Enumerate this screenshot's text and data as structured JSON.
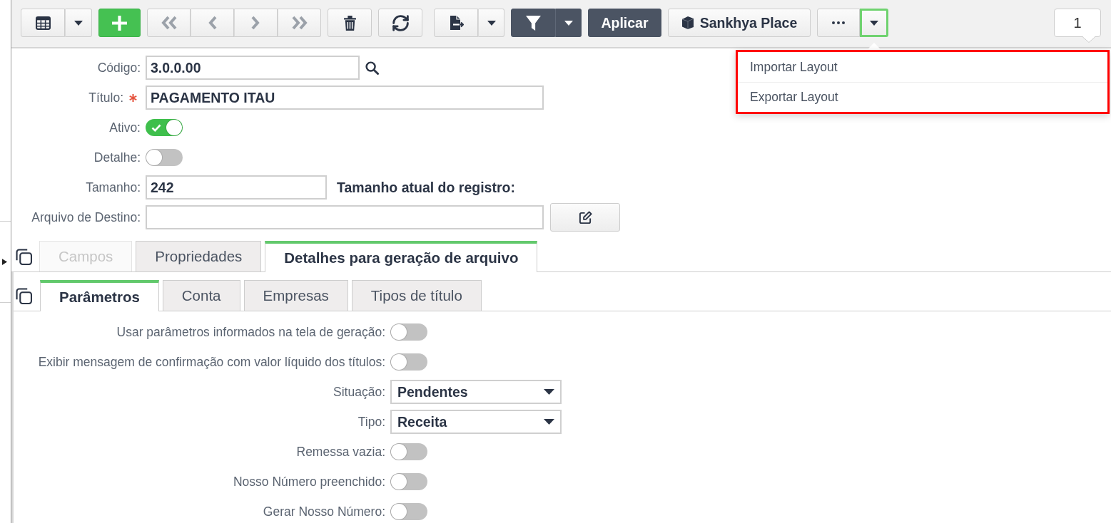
{
  "toolbar": {
    "apply_label": "Aplicar",
    "place_label": "Sankhya Place",
    "record_count": "1"
  },
  "more_menu": {
    "open": true,
    "highlighted": true,
    "items": [
      {
        "label": "Importar Layout"
      },
      {
        "label": "Exportar Layout"
      }
    ]
  },
  "form": [
    {
      "kind": "lookup",
      "label": "Código:",
      "required": false,
      "value": "3.0.0.00"
    },
    {
      "kind": "text",
      "label": "Título:",
      "required": true,
      "value": "PAGAMENTO ITAU"
    },
    {
      "kind": "switch",
      "label": "Ativo:",
      "required": false,
      "on": true
    },
    {
      "kind": "switch",
      "label": "Detalhe:",
      "required": false,
      "on": false
    },
    {
      "kind": "number",
      "label": "Tamanho:",
      "required": false,
      "value": "242",
      "note": "Tamanho atual do registro:"
    },
    {
      "kind": "file",
      "label": "Arquivo de Destino:",
      "required": false
    }
  ],
  "tabs": [
    {
      "label": "Campos",
      "selected": false,
      "disabled": true
    },
    {
      "label": "Propriedades",
      "selected": false,
      "disabled": false
    },
    {
      "label": "Detalhes para geração de arquivo",
      "selected": true,
      "disabled": false
    }
  ],
  "subtabs": [
    {
      "label": "Parâmetros",
      "selected": true
    },
    {
      "label": "Conta",
      "selected": false
    },
    {
      "label": "Empresas",
      "selected": false
    },
    {
      "label": "Tipos de título",
      "selected": false
    }
  ],
  "parameters": [
    {
      "kind": "switch",
      "label": "Usar parâmetros informados na tela de geração:",
      "on": false
    },
    {
      "kind": "switch",
      "label": "Exibir mensagem de confirmação com valor líquido dos títulos:",
      "on": false
    },
    {
      "kind": "select",
      "label": "Situação:",
      "value": "Pendentes"
    },
    {
      "kind": "select",
      "label": "Tipo:",
      "value": "Receita"
    },
    {
      "kind": "switch",
      "label": "Remessa vazia:",
      "on": false
    },
    {
      "kind": "switch",
      "label": "Nosso Número preenchido:",
      "on": false
    },
    {
      "kind": "switch",
      "label": "Gerar Nosso Número:",
      "on": false
    }
  ]
}
